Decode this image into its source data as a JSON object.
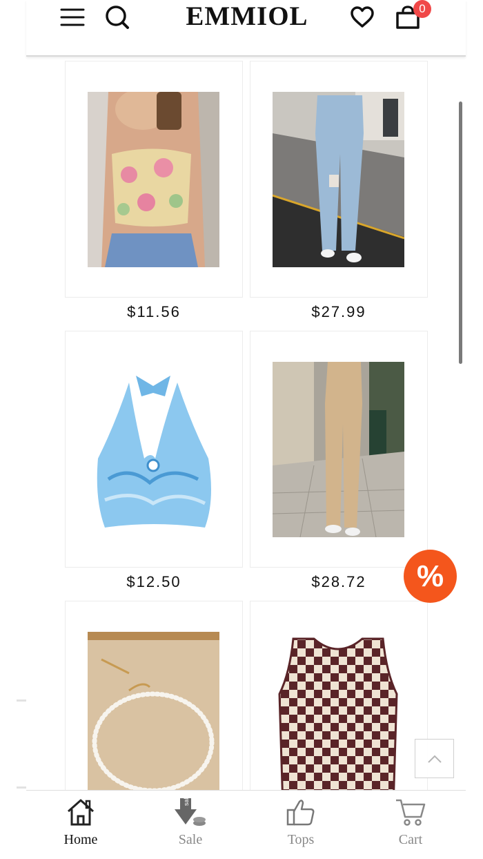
{
  "header": {
    "logo": "EMMIOL",
    "cart_count": "0"
  },
  "products": [
    {
      "price": "$11.56",
      "image": "floral-lace-cami-top"
    },
    {
      "price": "$27.99",
      "image": "ripped-flare-jeans"
    },
    {
      "price": "$12.50",
      "image": "blue-swirl-halter-top"
    },
    {
      "price": "$28.72",
      "image": "tan-flare-pants"
    },
    {
      "price": "",
      "image": "pearl-necklace"
    },
    {
      "price": "",
      "image": "checkered-knit-tank"
    }
  ],
  "discount_badge": "%",
  "bottom_nav": [
    {
      "label": "Home",
      "icon": "home-icon",
      "active": true
    },
    {
      "label": "Sale",
      "icon": "sale-tag-icon",
      "active": false
    },
    {
      "label": "Tops",
      "icon": "thumbs-up-icon",
      "active": false
    },
    {
      "label": "Cart",
      "icon": "shopping-cart-icon",
      "active": false
    }
  ],
  "colors": {
    "accent": "#f4561c",
    "badge": "#f04848"
  }
}
